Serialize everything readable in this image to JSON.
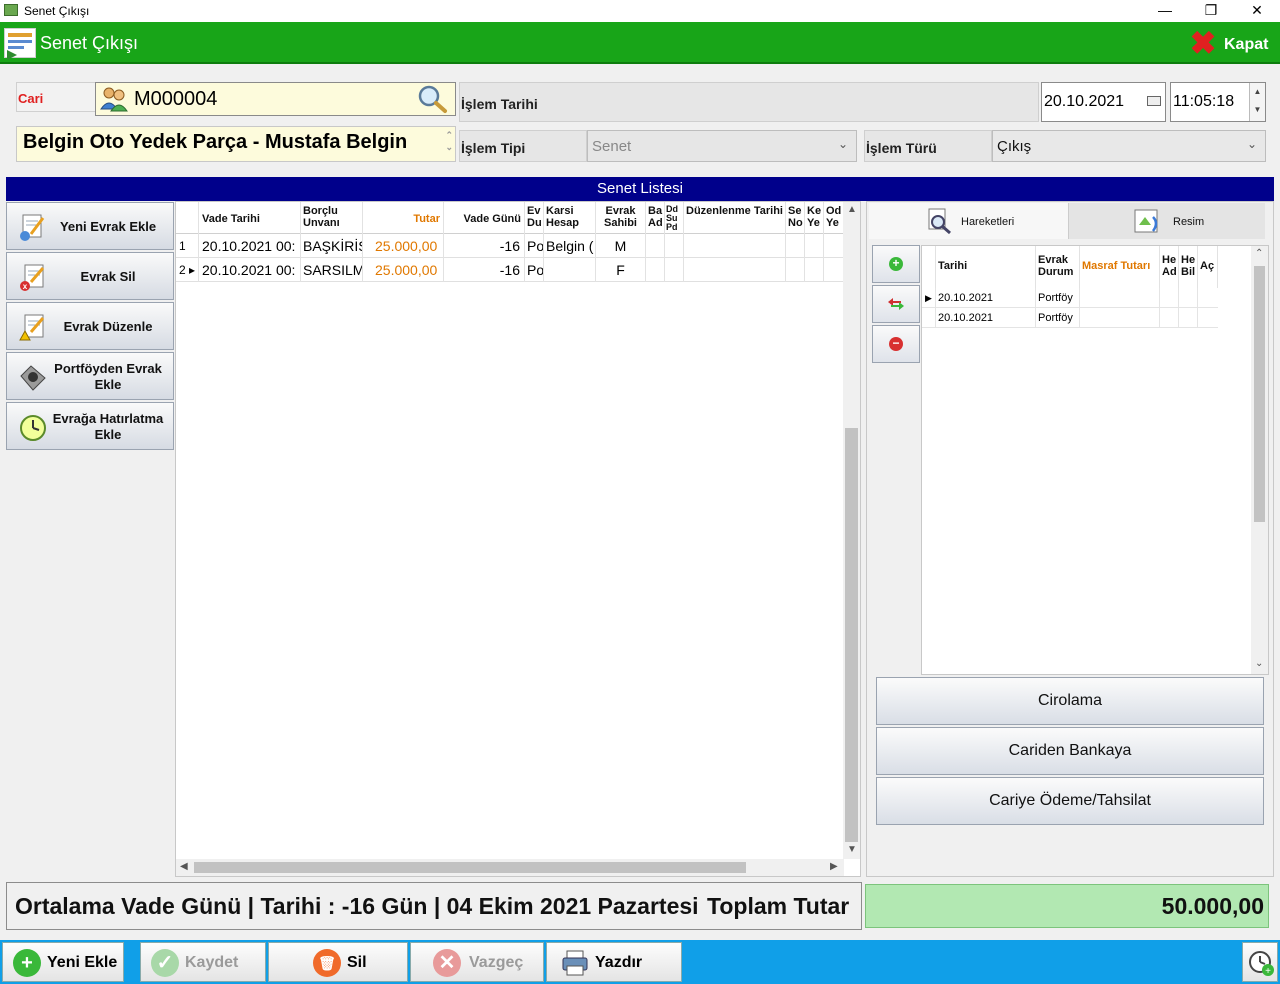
{
  "window": {
    "title": "Senet Çıkışı",
    "minimize": "—",
    "maximize": "❐",
    "close": "✕"
  },
  "header": {
    "title": "Senet Çıkışı",
    "close_label": "Kapat"
  },
  "form": {
    "cari_label": "Cari",
    "cari_code": "M000004",
    "cari_name": "Belgin Oto Yedek Parça - Mustafa Belgin",
    "islem_tarihi_label": "İşlem Tarihi",
    "islem_tarihi": "20.10.2021",
    "islem_saati": "11:05:18",
    "islem_tipi_label": "İşlem Tipi",
    "islem_tipi": "Senet",
    "islem_turu_label": "İşlem Türü",
    "islem_turu": "Çıkış"
  },
  "list_title": "Senet Listesi",
  "side_buttons": [
    {
      "label": "Yeni Evrak Ekle"
    },
    {
      "label": "Evrak Sil"
    },
    {
      "label": "Evrak Düzenle"
    },
    {
      "label": "Portföyden Evrak Ekle"
    },
    {
      "label": "Evrağa Hatırlatma Ekle"
    }
  ],
  "grid": {
    "columns": [
      "Vade Tarihi",
      "Borçlu Unvanı",
      "Tutar",
      "Vade Günü",
      "Ev Du",
      "Karsi Hesap",
      "Evrak Sahibi",
      "Ba Ad",
      "Dd Su Pd",
      "Düzenlenme Tarihi",
      "Se No",
      "Ke Ye",
      "Od Ye"
    ],
    "rows": [
      {
        "no": "1",
        "vade": "20.10.2021 00:",
        "borclu": "BAŞKİRİŞ",
        "tutar": "25.000,00",
        "gun": "-16",
        "evdu": "Po",
        "karsi": "Belgin (",
        "sahibi": "M"
      },
      {
        "no": "2",
        "vade": "20.10.2021 00:",
        "borclu": "SARSILMA",
        "tutar": "25.000,00",
        "gun": "-16",
        "evdu": "Po",
        "karsi": "",
        "sahibi": "F"
      }
    ]
  },
  "right": {
    "tab_hareketler": "Hareketleri",
    "tab_resim": "Resim",
    "hcolumns": [
      "Tarihi",
      "Evrak Durum",
      "Masraf Tutarı",
      "He Ad",
      "He Bil",
      "Aç"
    ],
    "hrows": [
      {
        "tarih": "20.10.2021",
        "durum": "Portföy"
      },
      {
        "tarih": "20.10.2021",
        "durum": "Portföy"
      }
    ],
    "actions": [
      "Cirolama",
      "Cariden Bankaya",
      "Cariye Ödeme/Tahsilat"
    ]
  },
  "summary": {
    "vade_text": "Ortalama Vade Günü | Tarihi : -16 Gün | 04 Ekim 2021 Pazartesi",
    "toplam_label": "Toplam Tutar",
    "toplam": "50.000,00"
  },
  "toolbar": {
    "yeni_ekle": "Yeni Ekle",
    "kaydet": "Kaydet",
    "sil": "Sil",
    "vazgec": "Vazgeç",
    "yazdir": "Yazdır"
  },
  "colors": {
    "header_green": "#18a518",
    "list_header_navy": "#00008b",
    "toolbar_blue": "#109fe8",
    "amount_orange": "#e07800",
    "total_green": "#b2e8b2"
  }
}
